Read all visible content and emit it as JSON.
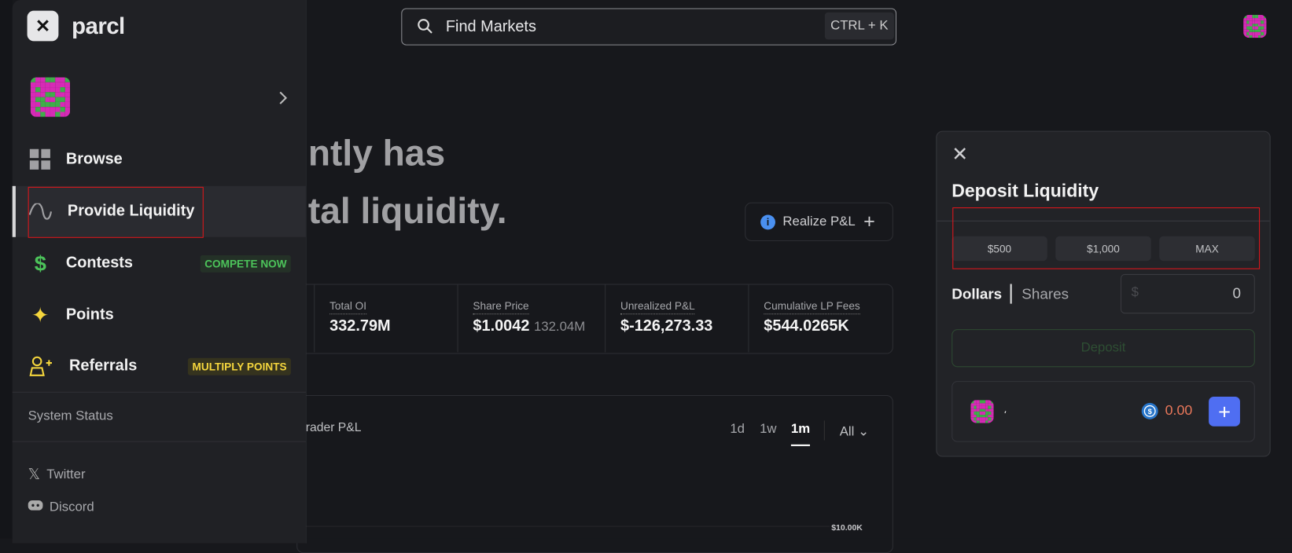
{
  "sidebar": {
    "logo": "parcl",
    "close_icon": "close-icon",
    "nav": [
      {
        "label": "Browse",
        "icon": "grid-icon"
      },
      {
        "label": "Provide Liquidity",
        "icon": "wave-icon"
      },
      {
        "label": "Contests",
        "icon": "dollar-icon",
        "badge": "COMPETE NOW"
      },
      {
        "label": "Points",
        "icon": "sparkle-icon",
        "badge": ""
      },
      {
        "label": "Referrals",
        "icon": "user-plus-icon",
        "badge": "MULTIPLY POINTS"
      }
    ],
    "system_status": "System Status",
    "links": [
      {
        "label": "Twitter",
        "icon": "x-icon"
      },
      {
        "label": "Discord",
        "icon": "discord-icon"
      }
    ]
  },
  "search": {
    "placeholder": "Find Markets",
    "shortcut": "CTRL + K"
  },
  "hero": {
    "line1": "ntly has",
    "line2": "tal liquidity."
  },
  "realize_button": "Realize P&L",
  "stats": [
    {
      "title": "Total OI",
      "value": "332.79M"
    },
    {
      "title": "Share Price",
      "value": "$1.0042",
      "sub": "132.04M"
    },
    {
      "title": "Unrealized P&L",
      "value": "$-126,273.33"
    },
    {
      "title": "Cumulative LP Fees",
      "value": "$544.0265K"
    }
  ],
  "chart_card": {
    "title": "rader P&L",
    "ranges": [
      "1d",
      "1w",
      "1m"
    ],
    "selected_range": "1m",
    "dropdown": "All",
    "axis_label": "$10.00K"
  },
  "deposit": {
    "title": "Deposit Liquidity",
    "quick_amounts": [
      "$500",
      "$1,000",
      "MAX"
    ],
    "unit_tabs": [
      "Dollars",
      "Shares"
    ],
    "selected_unit": "Dollars",
    "amount_prefix": "$",
    "amount_value": "0",
    "submit": "Deposit",
    "wallet_name": "،",
    "balance": "0.00"
  },
  "colors": {
    "accent_green": "#4cc35a",
    "accent_yellow": "#f5d63d",
    "balance": "#e8775a",
    "plus_button": "#4f6ef2",
    "info": "#4a90f0"
  }
}
